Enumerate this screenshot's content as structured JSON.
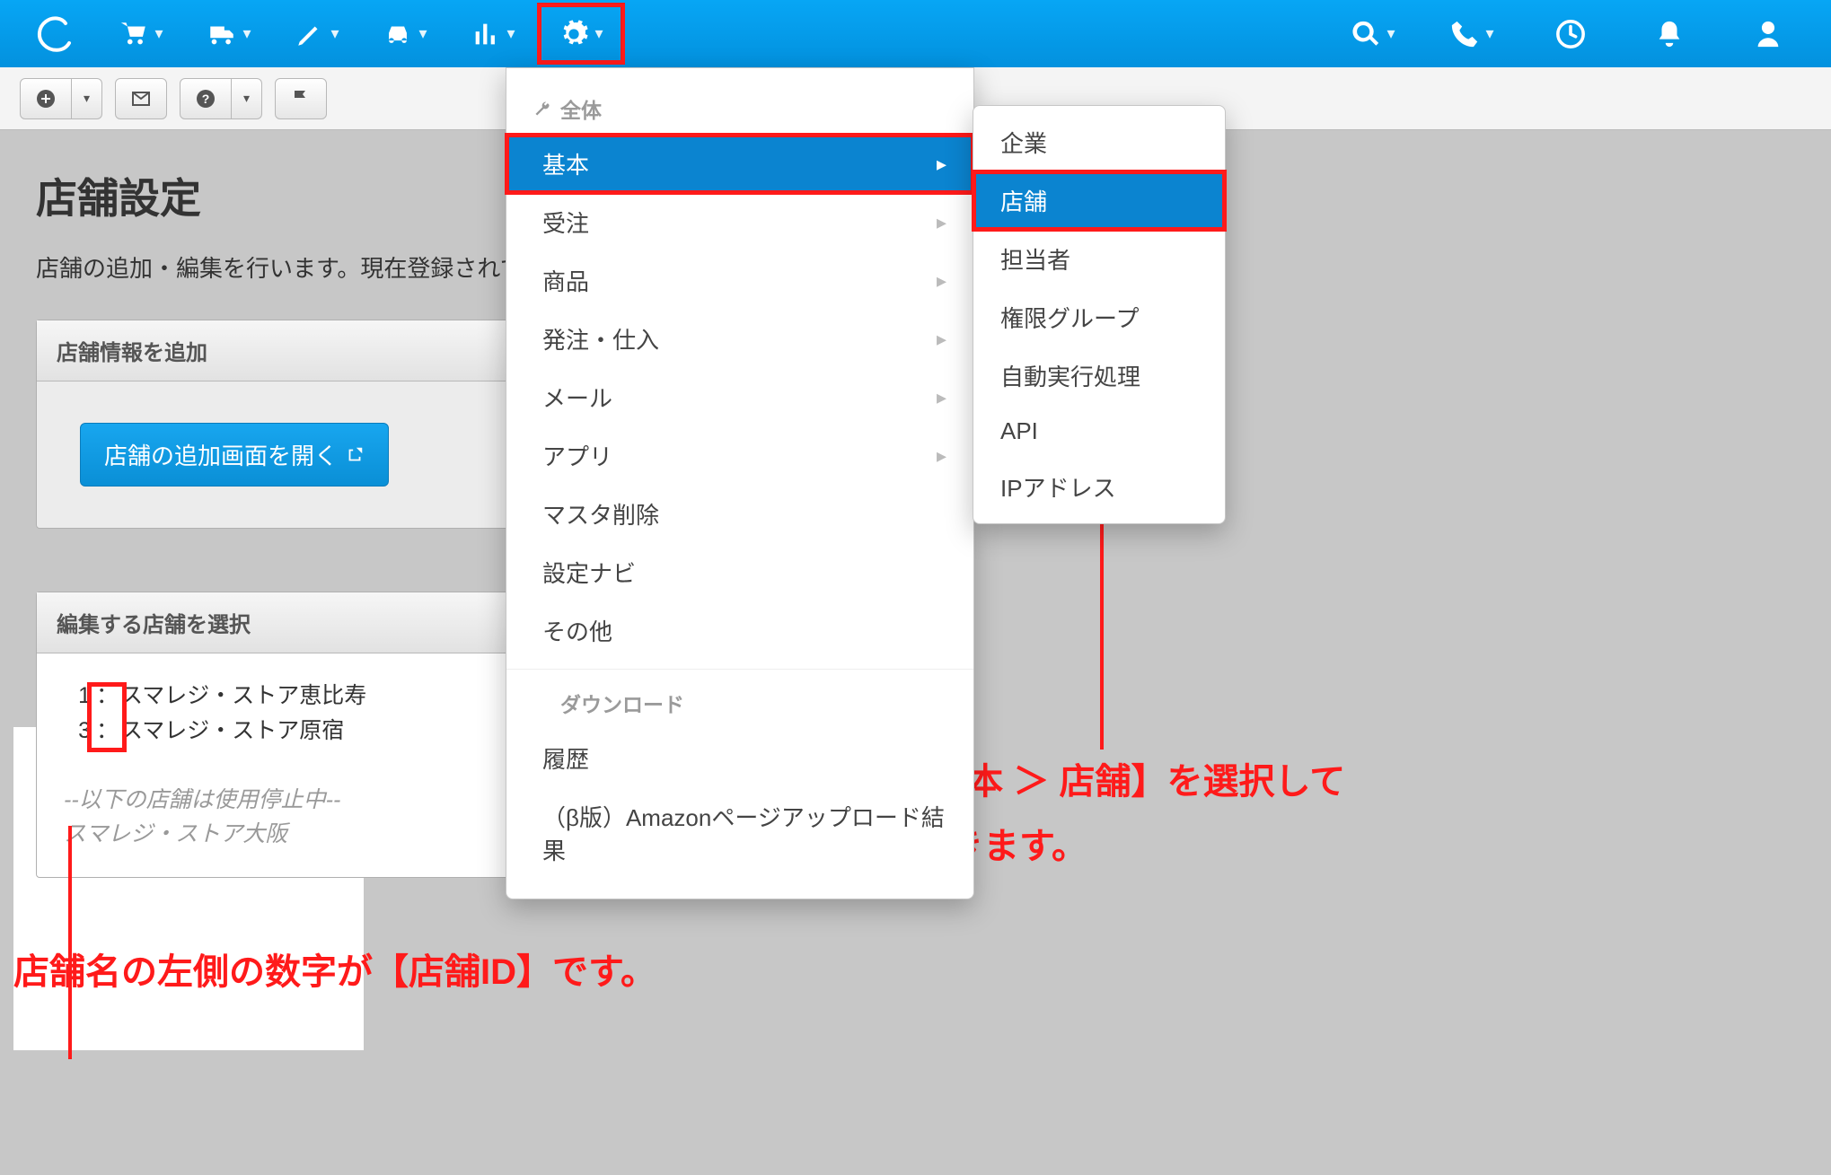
{
  "page": {
    "title": "店舗設定",
    "description": "店舗の追加・編集を行います。現在登録されてい"
  },
  "panel_add": {
    "header": "店舗情報を追加",
    "button": "店舗の追加画面を開く"
  },
  "panel_select": {
    "header": "編集する店舗を選択",
    "stores": [
      {
        "id": "1",
        "sep": "：",
        "name": "スマレジ・ストア恵比寿"
      },
      {
        "id": "3",
        "sep": "：",
        "name": "スマレジ・ストア原宿"
      }
    ],
    "inactive_note": "--以下の店舗は使用停止中--",
    "inactive_stores": [
      {
        "name": "スマレジ・ストア大阪"
      }
    ]
  },
  "dropdown": {
    "section1": "全体",
    "items1": [
      {
        "label": "基本",
        "hasSub": true,
        "active": true,
        "highlighted": true
      },
      {
        "label": "受注",
        "hasSub": true
      },
      {
        "label": "商品",
        "hasSub": true
      },
      {
        "label": "発注・仕入",
        "hasSub": true
      },
      {
        "label": "メール",
        "hasSub": true
      },
      {
        "label": "アプリ",
        "hasSub": true
      },
      {
        "label": "マスタ削除"
      },
      {
        "label": "設定ナビ"
      },
      {
        "label": "その他"
      }
    ],
    "section2": "ダウンロード",
    "items2": [
      {
        "label": "履歴"
      },
      {
        "label": "（β版）Amazonページアップロード結果"
      }
    ]
  },
  "submenu": {
    "items": [
      {
        "label": "企業"
      },
      {
        "label": "店舗",
        "active": true,
        "highlighted": true
      },
      {
        "label": "担当者"
      },
      {
        "label": "権限グループ"
      },
      {
        "label": "自動実行処理"
      },
      {
        "label": "API"
      },
      {
        "label": "IPアドレス"
      }
    ]
  },
  "annotations": {
    "text1_line1": "【歯車マーク ＞ 基本 ＞ 店舗】を選択して",
    "text1_line2": "店舗設定画面を開きます。",
    "text2": "店舗名の左側の数字が【店舗ID】です。"
  }
}
